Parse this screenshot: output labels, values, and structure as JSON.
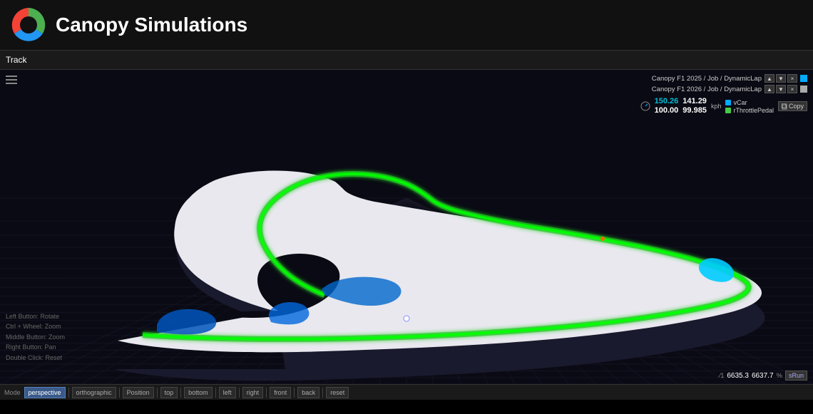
{
  "header": {
    "title": "Canopy Simulations",
    "logo_alt": "Canopy logo"
  },
  "toolbar": {
    "title": "Track",
    "hamburger_label": "Menu"
  },
  "laps": [
    {
      "label": "Canopy F1 2025 / Job / DynamicLap",
      "color": "#00aaff",
      "controls": [
        "▲",
        "▼",
        "×"
      ]
    },
    {
      "label": "Canopy F1 2026 / Job / DynamicLap",
      "color": "#aaaaaa",
      "controls": [
        "▲",
        "▼",
        "×"
      ]
    }
  ],
  "values": {
    "v1": "150.26",
    "v2": "141.29",
    "unit": "kph",
    "v3": "100.00",
    "v4": "99.985",
    "legend": [
      {
        "label": "vCar",
        "color": "#00aaff"
      },
      {
        "label": "rThrottlePedal",
        "color": "#44cc44"
      }
    ]
  },
  "copy_label": "Copy",
  "bottom_left": {
    "line1": "Left Button: Rotate",
    "line2": "Ctrl + Wheel: Zoom",
    "line3": "Middle Button: Zoom",
    "line4": "Right Button: Pan",
    "line5": "Double Click: Reset"
  },
  "bottom_right": {
    "slash": "⁄1",
    "coord1": "6635.3",
    "coord2": "6637.7",
    "srun_label": "sRun"
  },
  "mode_bar": {
    "mode_label": "Mode",
    "buttons": [
      {
        "label": "perspective",
        "active": true
      },
      {
        "label": "orthographic",
        "active": false
      },
      {
        "label": "Position",
        "active": false
      },
      {
        "label": "top",
        "active": false
      },
      {
        "label": "bottom",
        "active": false
      },
      {
        "label": "left",
        "active": false
      },
      {
        "label": "right",
        "active": false
      },
      {
        "label": "front",
        "active": false
      },
      {
        "label": "back",
        "active": false
      },
      {
        "label": "reset",
        "active": false
      }
    ]
  }
}
